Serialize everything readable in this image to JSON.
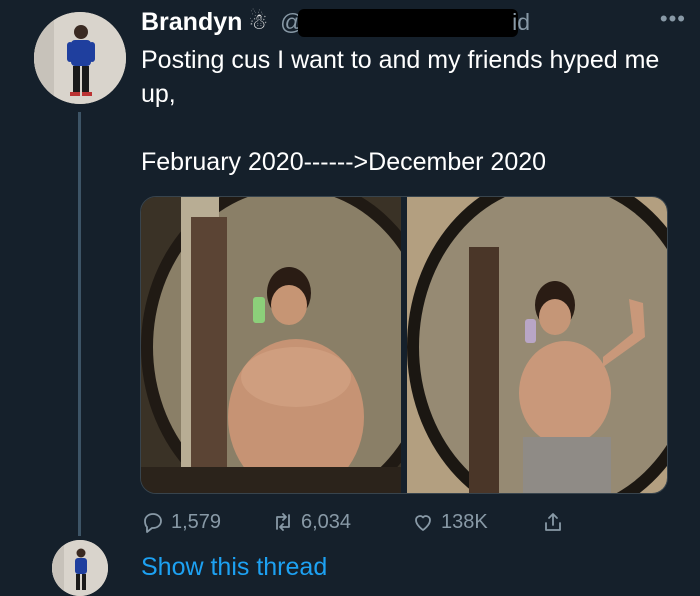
{
  "tweet": {
    "display_name": "Brandyn",
    "name_emoji": "☃",
    "handle_prefix": "@",
    "handle_suffix": "id",
    "more_label": "•••",
    "text_line_1": "Posting cus I want to and my friends hyped me up,",
    "text_line_2": "February 2020------>December 2020"
  },
  "actions": {
    "reply_count": "1,579",
    "retweet_count": "6,034",
    "like_count": "138K"
  },
  "thread": {
    "show_thread_label": "Show this thread"
  },
  "icons": {
    "reply": "reply-icon",
    "retweet": "retweet-icon",
    "like": "heart-icon",
    "share": "share-icon"
  },
  "colors": {
    "background": "#15202b",
    "text": "#ffffff",
    "secondary": "#8899a6",
    "link": "#1da1f2"
  }
}
